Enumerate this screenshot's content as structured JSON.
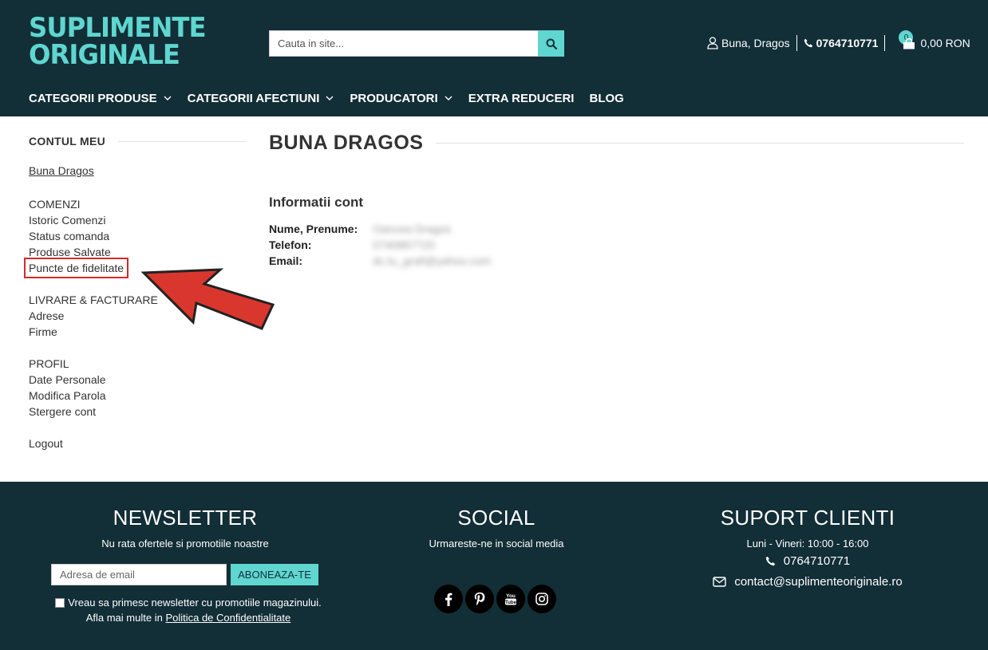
{
  "header": {
    "logo_line1": "SUPLIMENTE",
    "logo_line2": "ORIGINALE",
    "search_placeholder": "Cauta in site...",
    "greeting": "Buna, Dragos",
    "phone": "0764710771",
    "cart_count": "0",
    "cart_total": "0,00 RON"
  },
  "nav": [
    {
      "label": "CATEGORII PRODUSE",
      "has_dropdown": true
    },
    {
      "label": "CATEGORII AFECTIUNI",
      "has_dropdown": true
    },
    {
      "label": "PRODUCATORI",
      "has_dropdown": true
    },
    {
      "label": "EXTRA REDUCERI",
      "has_dropdown": false
    },
    {
      "label": "BLOG",
      "has_dropdown": false
    }
  ],
  "sidebar": {
    "title": "CONTUL MEU",
    "account_link": "Buna Dragos",
    "comenzi": {
      "heading": "COMENZI",
      "items": [
        "Istoric Comenzi",
        "Status comanda",
        "Produse Salvate",
        "Puncte de fidelitate"
      ]
    },
    "livrare": {
      "heading": "LIVRARE & FACTURARE",
      "items": [
        "Adrese",
        "Firme"
      ]
    },
    "profil": {
      "heading": "PROFIL",
      "items": [
        "Date Personale",
        "Modifica Parola",
        "Stergere cont"
      ]
    },
    "logout": "Logout"
  },
  "main": {
    "title": "BUNA DRAGOS",
    "info_heading": "Informatii cont",
    "fields": [
      {
        "label": "Nume, Prenume:",
        "value": "Oancea Dragos"
      },
      {
        "label": "Telefon:",
        "value": "0740867720"
      },
      {
        "label": "Email:",
        "value": "dc.tu_grafi@yahoo.com"
      }
    ]
  },
  "footer": {
    "newsletter": {
      "title": "NEWSLETTER",
      "subtitle": "Nu rata ofertele si promotiile noastre",
      "email_placeholder": "Adresa de email",
      "button": "ABONEAZA-TE",
      "consent": "Vreau sa primesc newsletter cu promotiile magazinului.",
      "more_prefix": "Afla mai multe in",
      "policy_link": "Politica de Confidentialitate"
    },
    "social": {
      "title": "SOCIAL",
      "subtitle": "Urmareste-ne in social media",
      "icons": [
        "facebook-icon",
        "pinterest-icon",
        "youtube-icon",
        "instagram-icon"
      ]
    },
    "support": {
      "title": "SUPORT CLIENTI",
      "hours": "Luni - Vineri: 10:00 - 16:00",
      "phone": "0764710771",
      "email": "contact@suplimenteoriginale.ro"
    }
  },
  "colors": {
    "dark": "#122e37",
    "accent": "#5fd6cf",
    "highlight": "#d42b26"
  }
}
